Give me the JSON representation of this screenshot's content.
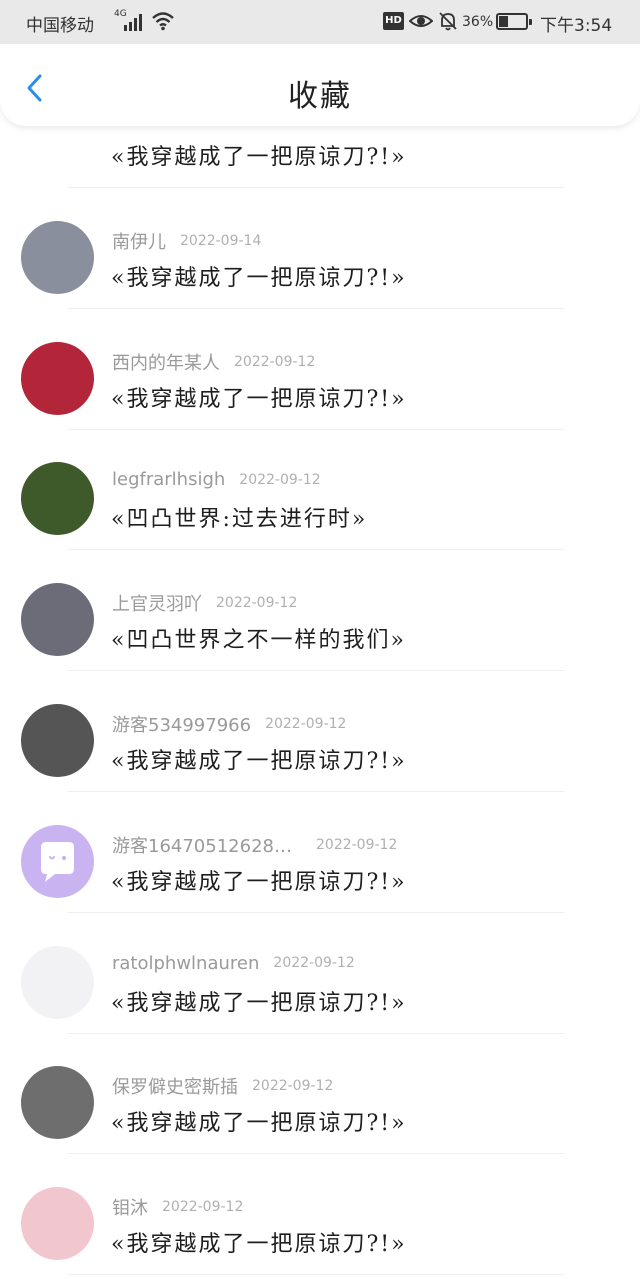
{
  "status_bar": {
    "carrier": "中国移动",
    "network": "4G",
    "hd_label": "HD",
    "battery_percent": "36%",
    "battery_level": 0.36,
    "time": "下午3:54"
  },
  "header": {
    "title": "收藏",
    "back_icon": "chevron-left-icon"
  },
  "colors": {
    "accent": "#2a8cf0",
    "username": "#9a9a9a",
    "date": "#b0b0b0",
    "title_text": "#1e1e1e"
  },
  "favorites": [
    {
      "user": "",
      "date": "",
      "work": "«我穿越成了一把原谅刀?!»",
      "avatar_bg": "#f3efe9"
    },
    {
      "user": "南伊儿",
      "date": "2022-09-14",
      "work": "«我穿越成了一把原谅刀?!»",
      "avatar_bg": "#8a8f9e"
    },
    {
      "user": "西内的年某人",
      "date": "2022-09-12",
      "work": "«我穿越成了一把原谅刀?!»",
      "avatar_bg": "#b3263a"
    },
    {
      "user": "legfrarlhsigh",
      "date": "2022-09-12",
      "work": "«凹凸世界:过去进行时»",
      "avatar_bg": "#3f5a2a"
    },
    {
      "user": "上官灵羽吖",
      "date": "2022-09-12",
      "work": "«凹凸世界之不一样的我们»",
      "avatar_bg": "#6c6c78"
    },
    {
      "user": "游客534997966",
      "date": "2022-09-12",
      "work": "«我穿越成了一把原谅刀?!»",
      "avatar_bg": "#555555"
    },
    {
      "user": "游客164705126283…",
      "date": "2022-09-12",
      "work": "«我穿越成了一把原谅刀?!»",
      "avatar_bg": "#c9b3f0"
    },
    {
      "user": "ratolphwlnauren",
      "date": "2022-09-12",
      "work": "«我穿越成了一把原谅刀?!»",
      "avatar_bg": "#f2f2f4"
    },
    {
      "user": "保罗僻史密斯插",
      "date": "2022-09-12",
      "work": "«我穿越成了一把原谅刀?!»",
      "avatar_bg": "#6e6e6e"
    },
    {
      "user": "钼沐",
      "date": "2022-09-12",
      "work": "«我穿越成了一把原谅刀?!»",
      "avatar_bg": "#f1c6cf"
    }
  ]
}
